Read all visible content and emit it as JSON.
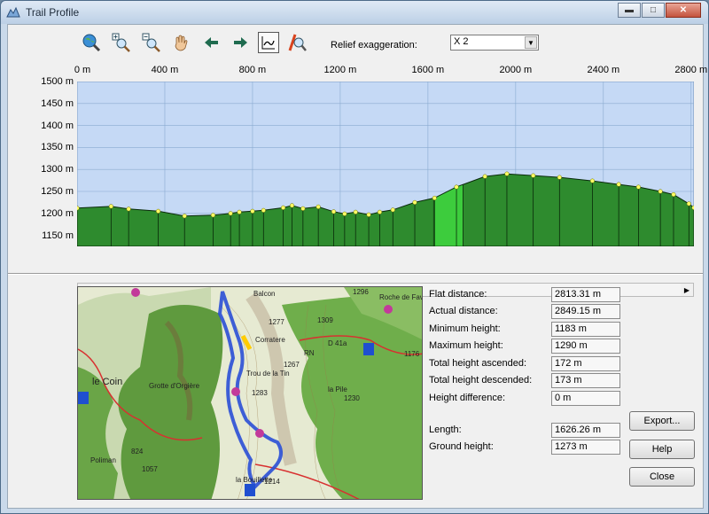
{
  "window": {
    "title": "Trail Profile"
  },
  "toolbar": {
    "icons": [
      "globe-zoom-icon",
      "zoom-in-icon",
      "zoom-out-icon",
      "pan-hand-icon",
      "arrow-left-icon",
      "arrow-right-icon",
      "profile-mode-icon",
      "trail-search-icon"
    ],
    "relief_label": "Relief exaggeration:",
    "relief_value": "X 2"
  },
  "chart_data": {
    "type": "area",
    "x_tick_labels": [
      "0 m",
      "400 m",
      "800 m",
      "1200 m",
      "1600 m",
      "2000 m",
      "2400 m",
      "2800 m"
    ],
    "y_tick_labels": [
      "1500 m",
      "1450 m",
      "1400 m",
      "1350 m",
      "1300 m",
      "1250 m",
      "1200 m",
      "1150 m"
    ],
    "xlim": [
      0,
      2813
    ],
    "ylim": [
      1125,
      1500
    ],
    "grid": true,
    "colors": {
      "background": "#c5d9f5",
      "grid": "#8aaad0",
      "fill": "#2e8b2e",
      "highlight": "#3dcc3d",
      "outline": "#0a2a0a",
      "point": "#ffff66"
    },
    "highlight_segment": [
      1626,
      1760
    ],
    "profile": [
      [
        0,
        1212
      ],
      [
        155,
        1216
      ],
      [
        235,
        1210
      ],
      [
        370,
        1205
      ],
      [
        490,
        1194
      ],
      [
        620,
        1196
      ],
      [
        700,
        1200
      ],
      [
        740,
        1203
      ],
      [
        800,
        1205
      ],
      [
        850,
        1207
      ],
      [
        940,
        1213
      ],
      [
        980,
        1218
      ],
      [
        1030,
        1211
      ],
      [
        1100,
        1215
      ],
      [
        1170,
        1204
      ],
      [
        1220,
        1199
      ],
      [
        1270,
        1203
      ],
      [
        1330,
        1197
      ],
      [
        1380,
        1203
      ],
      [
        1440,
        1208
      ],
      [
        1540,
        1225
      ],
      [
        1630,
        1235
      ],
      [
        1730,
        1260
      ],
      [
        1860,
        1284
      ],
      [
        1960,
        1290
      ],
      [
        2080,
        1286
      ],
      [
        2200,
        1282
      ],
      [
        2350,
        1274
      ],
      [
        2470,
        1266
      ],
      [
        2560,
        1260
      ],
      [
        2660,
        1250
      ],
      [
        2720,
        1243
      ],
      [
        2790,
        1222
      ],
      [
        2813,
        1213
      ]
    ]
  },
  "stats": [
    {
      "label": "Flat distance:",
      "value": "2813.31 m"
    },
    {
      "label": "Actual distance:",
      "value": "2849.15 m"
    },
    {
      "label": "Minimum height:",
      "value": "1183 m"
    },
    {
      "label": "Maximum height:",
      "value": "1290 m"
    },
    {
      "label": "Total height ascended:",
      "value": "172 m"
    },
    {
      "label": "Total height descended:",
      "value": "173 m"
    },
    {
      "label": "Height difference:",
      "value": "0 m"
    }
  ],
  "cursor_stats": [
    {
      "label": "Length:",
      "value": "1626.26 m"
    },
    {
      "label": "Ground height:",
      "value": "1273 m"
    }
  ],
  "buttons": {
    "export": "Export...",
    "help": "Help",
    "close": "Close"
  },
  "map": {
    "labels": [
      "Balcon",
      "1296",
      "Roche de Fave",
      "1277",
      "Corratere",
      "1309",
      "D 41a",
      "1267",
      "RN",
      "Trou de la Tin",
      "1283",
      "la Pile",
      "1230",
      "le Coin",
      "Grotte d'Orgière",
      "824",
      "1057",
      "Poliman",
      "la Bouillette",
      "1214",
      "1176"
    ],
    "colors": {
      "forest": "#5f9a3e",
      "pasture": "#e8ecd8",
      "rock": "#b5a48c",
      "trail": "#2a4fd6",
      "highlight": "#ffcc00",
      "road": "#d83030"
    }
  }
}
